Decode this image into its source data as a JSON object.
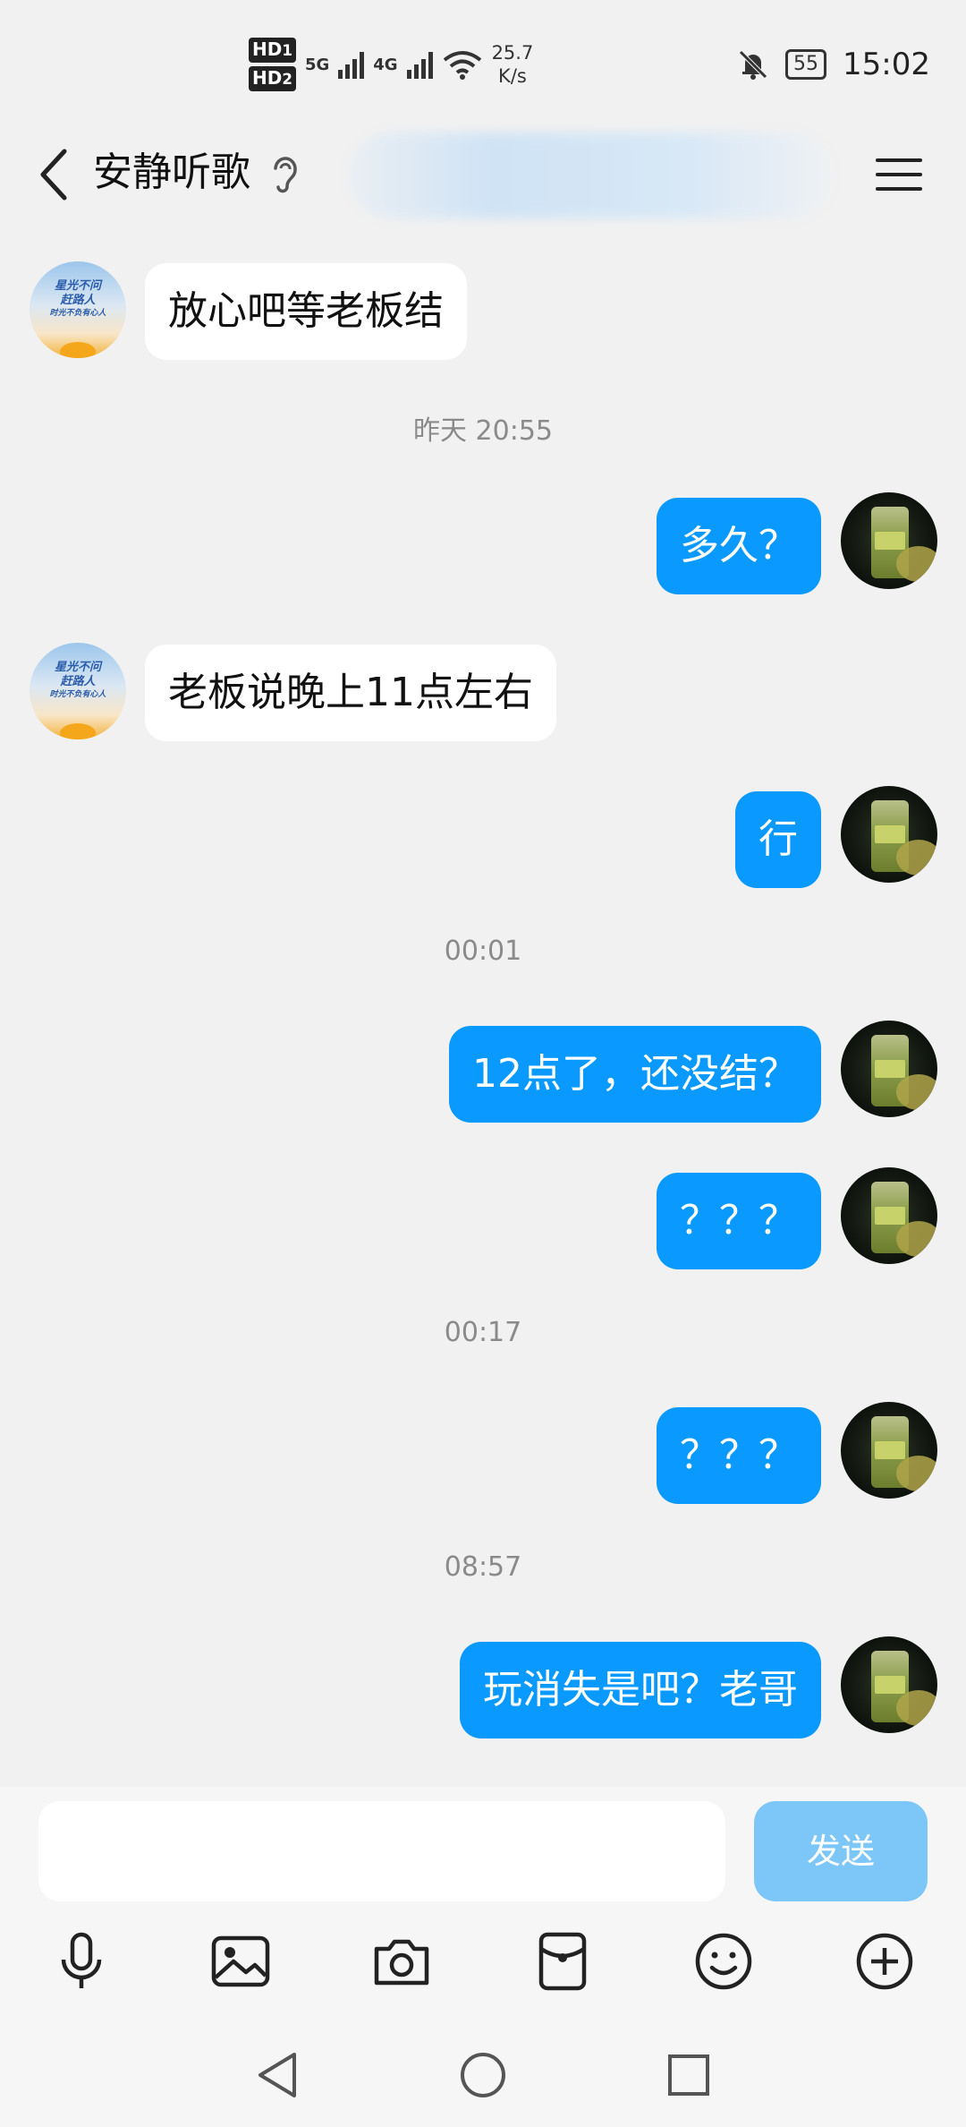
{
  "status_bar": {
    "sim1": "HD",
    "sim1_index": "1",
    "sim2": "HD",
    "sim2_index": "2",
    "network1": "5G",
    "network2": "4G",
    "speed_value": "25.7",
    "speed_unit": "K/s",
    "battery": "55",
    "time": "15:02"
  },
  "header": {
    "back_icon": "chevron-left-icon",
    "title": "安静听歌",
    "ear_icon": "ear-icon",
    "menu_icon": "hamburger-menu-icon"
  },
  "avatars": {
    "contact_text_line1": "星光不问",
    "contact_text_line2": "赶路人",
    "contact_text_line3": "时光不负有心人"
  },
  "messages": [
    {
      "type": "in",
      "text": "放心吧等老板结"
    },
    {
      "type": "time",
      "text": "昨天 20:55"
    },
    {
      "type": "out",
      "text": "多久？"
    },
    {
      "type": "in",
      "text": "老板说晚上11点左右"
    },
    {
      "type": "out",
      "text": "行"
    },
    {
      "type": "time",
      "text": "00:01"
    },
    {
      "type": "out",
      "text": "12点了，还没结？"
    },
    {
      "type": "out",
      "text": "？？？"
    },
    {
      "type": "time",
      "text": "00:17"
    },
    {
      "type": "out",
      "text": "？？？"
    },
    {
      "type": "time",
      "text": "08:57"
    },
    {
      "type": "out",
      "text": "玩消失是吧？老哥"
    }
  ],
  "composer": {
    "input_value": "",
    "send_label": "发送",
    "tools": [
      "microphone-icon",
      "image-icon",
      "camera-icon",
      "red-packet-icon",
      "emoji-icon",
      "plus-icon"
    ]
  },
  "colors": {
    "bubble_out": "#0a99ff",
    "bubble_in": "#ffffff",
    "send_disabled": "#7cc6f8",
    "background": "#f1f1f1"
  }
}
